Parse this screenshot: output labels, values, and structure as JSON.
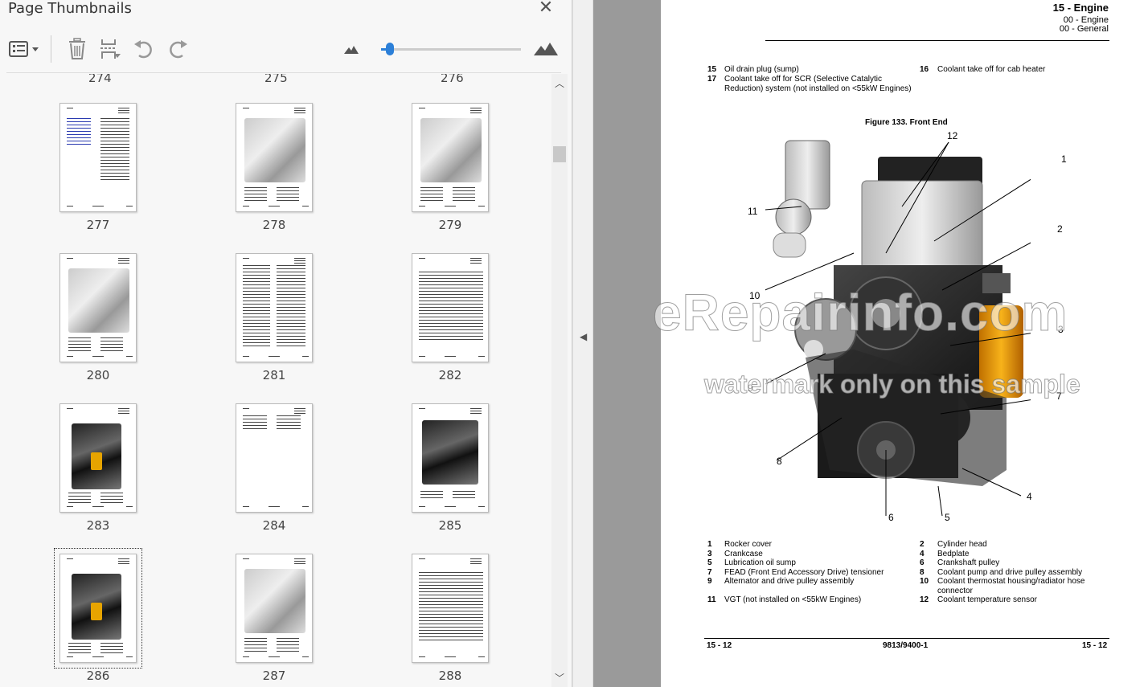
{
  "panel": {
    "title": "Page Thumbnails",
    "close_icon": "close-icon",
    "toolbar": {
      "options_icon": "thumbnail-options-icon",
      "delete_icon": "trash-icon",
      "insert_icon": "insert-pages-icon",
      "rotate_ccw_icon": "rotate-counterclockwise-icon",
      "rotate_cw_icon": "rotate-clockwise-icon",
      "zoom_out_icon": "small-mountain-icon",
      "zoom_in_icon": "large-mountain-icon",
      "zoom_level": 0.05
    },
    "prev_row_labels": [
      "274",
      "275",
      "276"
    ],
    "thumbnails": [
      {
        "label": "277",
        "style": "text-toc"
      },
      {
        "label": "278",
        "style": "engine-light"
      },
      {
        "label": "279",
        "style": "engine-light"
      },
      {
        "label": "280",
        "style": "engine-light"
      },
      {
        "label": "281",
        "style": "text"
      },
      {
        "label": "282",
        "style": "table"
      },
      {
        "label": "283",
        "style": "engine-yellow"
      },
      {
        "label": "284",
        "style": "list"
      },
      {
        "label": "285",
        "style": "engine-dark"
      },
      {
        "label": "286",
        "style": "engine-yellow",
        "selected": true
      },
      {
        "label": "287",
        "style": "engine-light"
      },
      {
        "label": "288",
        "style": "table"
      }
    ]
  },
  "divider": {
    "collapse_icon": "collapse-left-icon"
  },
  "document": {
    "header": {
      "title": "15 - Engine",
      "sub1": "00 - Engine",
      "sub2": "00 - General"
    },
    "top_items": [
      {
        "num": "15",
        "text": "Oil drain plug (sump)"
      },
      {
        "num": "17",
        "text": "Coolant take off for SCR (Selective Catalytic Reduction) system (not installed on <55kW Engines)"
      },
      {
        "num": "16",
        "text": "Coolant take off for cab heater"
      }
    ],
    "figure_title": "Figure 133. Front End",
    "callouts": [
      "12",
      "1",
      "11",
      "2",
      "10",
      "3",
      "9",
      "7",
      "8",
      "4",
      "6",
      "5"
    ],
    "watermark_main": "eRepairinfo.com",
    "watermark_sub": "watermark only on this sample",
    "legend": [
      {
        "num": "1",
        "text": "Rocker cover"
      },
      {
        "num": "2",
        "text": "Cylinder head"
      },
      {
        "num": "3",
        "text": "Crankcase"
      },
      {
        "num": "4",
        "text": "Bedplate"
      },
      {
        "num": "5",
        "text": "Lubrication oil sump"
      },
      {
        "num": "6",
        "text": "Crankshaft pulley"
      },
      {
        "num": "7",
        "text": "FEAD (Front End Accessory Drive) tensioner"
      },
      {
        "num": "8",
        "text": "Coolant pump and drive pulley assembly"
      },
      {
        "num": "9",
        "text": "Alternator and drive pulley assembly"
      },
      {
        "num": "10",
        "text": "Coolant thermostat housing/radiator hose connector"
      },
      {
        "num": "11",
        "text": "VGT (not installed on <55kW Engines)"
      },
      {
        "num": "12",
        "text": "Coolant temperature sensor"
      }
    ],
    "footer": {
      "left": "15 - 12",
      "center": "9813/9400-1",
      "right": "15 - 12"
    }
  }
}
